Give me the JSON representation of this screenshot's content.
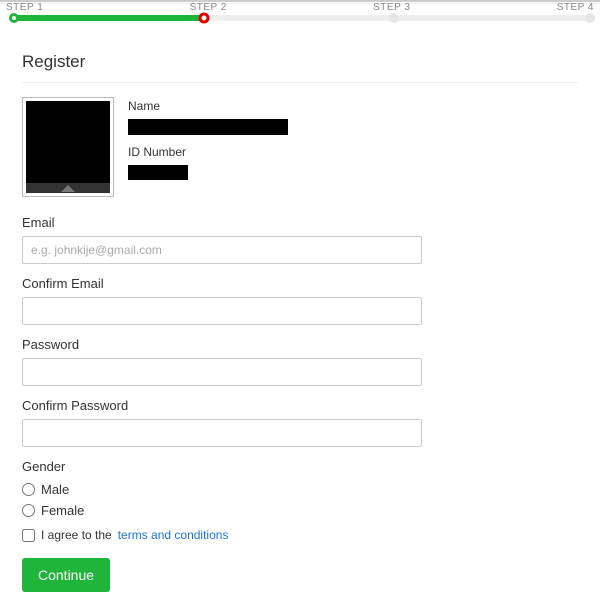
{
  "stepper": {
    "steps": [
      "STEP 1",
      "STEP 2",
      "STEP 3",
      "STEP 4"
    ],
    "fill_percent": 33
  },
  "heading": "Register",
  "profile": {
    "name_label": "Name",
    "id_label": "ID Number"
  },
  "fields": {
    "email": {
      "label": "Email",
      "placeholder": "e.g. johnkije@gmail.com",
      "value": ""
    },
    "confirm_email": {
      "label": "Confirm Email",
      "placeholder": "",
      "value": ""
    },
    "password": {
      "label": "Password",
      "placeholder": "",
      "value": ""
    },
    "confirm_password": {
      "label": "Confirm Password",
      "placeholder": "",
      "value": ""
    }
  },
  "gender": {
    "label": "Gender",
    "options": {
      "male": "Male",
      "female": "Female"
    }
  },
  "agree": {
    "prefix": "I agree to the ",
    "link": "terms and conditions"
  },
  "buttons": {
    "continue": "Continue"
  }
}
